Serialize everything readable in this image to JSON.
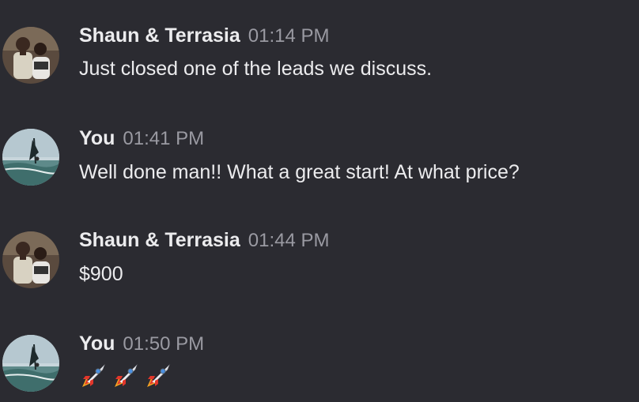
{
  "messages": [
    {
      "author": "Shaun & Terrasia",
      "time": "01:14 PM",
      "text": "Just closed one of the leads we discuss.",
      "avatar": "couple-photo"
    },
    {
      "author": "You",
      "time": "01:41 PM",
      "text": "Well done man!! What a great start! At what price?",
      "avatar": "windsurfer-photo"
    },
    {
      "author": "Shaun & Terrasia",
      "time": "01:44 PM",
      "text": "$900",
      "avatar": "couple-photo"
    },
    {
      "author": "You",
      "time": "01:50 PM",
      "text": "",
      "avatar": "windsurfer-photo",
      "reactions": [
        "rocket-emoji",
        "rocket-emoji",
        "rocket-emoji"
      ]
    }
  ]
}
